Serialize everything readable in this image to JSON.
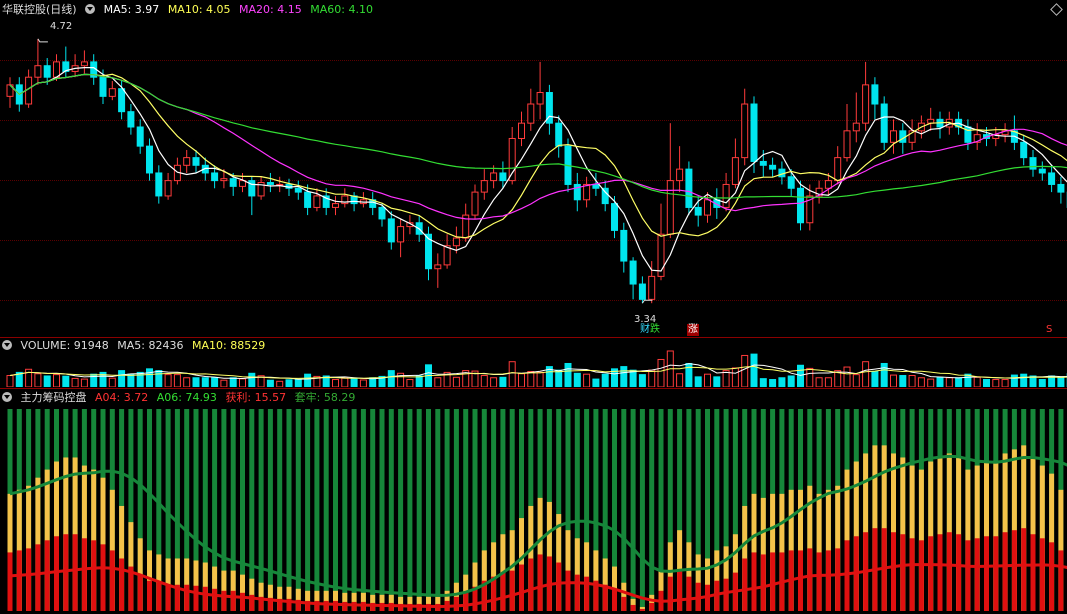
{
  "header": {
    "title": "华联控股(日线)",
    "ma5": "MA5: 3.97",
    "ma10": "MA10: 4.05",
    "ma20": "MA20: 4.15",
    "ma60": "MA60: 4.10"
  },
  "volume_header": {
    "label": "VOLUME: 91948",
    "ma5": "MA5: 82436",
    "ma10": "MA10: 88529"
  },
  "chip_header": {
    "title": "主力筹码控盘",
    "a04": "A04: 3.72",
    "a06": "A06: 74.93",
    "profit": "获利: 15.57",
    "trapped": "套牢: 58.29"
  },
  "annotations": {
    "high": "4.72",
    "low": "3.34",
    "signal_fall": "跌",
    "signal_finance": "财",
    "signal_rise": "涨",
    "signal_s": "S"
  },
  "colors": {
    "up": "#ff3b3b",
    "down": "#00e5ee",
    "ma5": "#ffffff",
    "ma10": "#ffff66",
    "ma20": "#ff33ff",
    "ma60": "#33dd33",
    "chip_green": "#16873a",
    "chip_gold": "#f4c34a",
    "chip_red": "#e01010"
  },
  "chart_data": [
    {
      "type": "candlestick",
      "title": "华联控股(日线)",
      "y_axis_range": [
        3.2,
        4.85
      ],
      "high_label": 4.72,
      "low_label": 3.34,
      "series": [
        {
          "name": "MA5",
          "last": 3.97
        },
        {
          "name": "MA10",
          "last": 4.05
        },
        {
          "name": "MA20",
          "last": 4.15
        },
        {
          "name": "MA60",
          "last": 4.1
        }
      ],
      "candles": [
        [
          4.42,
          4.48,
          4.36,
          4.52
        ],
        [
          4.48,
          4.38,
          4.34,
          4.52
        ],
        [
          4.38,
          4.52,
          4.36,
          4.56
        ],
        [
          4.52,
          4.58,
          4.48,
          4.72
        ],
        [
          4.58,
          4.52,
          4.48,
          4.62
        ],
        [
          4.52,
          4.6,
          4.5,
          4.64
        ],
        [
          4.6,
          4.55,
          4.52,
          4.68
        ],
        [
          4.55,
          4.58,
          4.52,
          4.64
        ],
        [
          4.58,
          4.6,
          4.54,
          4.66
        ],
        [
          4.6,
          4.52,
          4.48,
          4.64
        ],
        [
          4.52,
          4.42,
          4.38,
          4.56
        ],
        [
          4.42,
          4.46,
          4.4,
          4.5
        ],
        [
          4.46,
          4.34,
          4.3,
          4.5
        ],
        [
          4.34,
          4.26,
          4.22,
          4.38
        ],
        [
          4.26,
          4.16,
          4.12,
          4.3
        ],
        [
          4.16,
          4.02,
          3.98,
          4.2
        ],
        [
          4.02,
          3.9,
          3.86,
          4.06
        ],
        [
          3.9,
          3.98,
          3.88,
          4.02
        ],
        [
          3.98,
          4.06,
          3.96,
          4.1
        ],
        [
          4.06,
          4.1,
          4.02,
          4.14
        ],
        [
          4.1,
          4.06,
          4.02,
          4.14
        ],
        [
          4.06,
          4.02,
          3.98,
          4.1
        ],
        [
          4.02,
          3.98,
          3.94,
          4.06
        ],
        [
          3.98,
          3.99,
          3.94,
          4.04
        ],
        [
          3.99,
          3.95,
          3.9,
          4.02
        ],
        [
          3.95,
          3.98,
          3.92,
          4.02
        ],
        [
          3.98,
          3.9,
          3.8,
          4.0
        ],
        [
          3.9,
          3.97,
          3.88,
          4.0
        ],
        [
          3.97,
          3.96,
          3.92,
          4.02
        ],
        [
          3.96,
          3.96,
          3.92,
          4.0
        ],
        [
          3.96,
          3.94,
          3.9,
          3.99
        ],
        [
          3.94,
          3.92,
          3.88,
          3.98
        ],
        [
          3.92,
          3.84,
          3.8,
          3.96
        ],
        [
          3.84,
          3.9,
          3.82,
          3.94
        ],
        [
          3.9,
          3.84,
          3.8,
          3.94
        ],
        [
          3.84,
          3.86,
          3.8,
          3.9
        ],
        [
          3.86,
          3.9,
          3.84,
          3.94
        ],
        [
          3.9,
          3.86,
          3.82,
          3.92
        ],
        [
          3.86,
          3.88,
          3.84,
          3.92
        ],
        [
          3.88,
          3.84,
          3.8,
          3.92
        ],
        [
          3.84,
          3.78,
          3.74,
          3.86
        ],
        [
          3.78,
          3.66,
          3.62,
          3.82
        ],
        [
          3.66,
          3.74,
          3.58,
          3.78
        ],
        [
          3.74,
          3.76,
          3.7,
          3.8
        ],
        [
          3.76,
          3.7,
          3.66,
          3.8
        ],
        [
          3.7,
          3.52,
          3.46,
          3.74
        ],
        [
          3.52,
          3.54,
          3.42,
          3.6
        ],
        [
          3.54,
          3.64,
          3.52,
          3.7
        ],
        [
          3.64,
          3.68,
          3.6,
          3.74
        ],
        [
          3.68,
          3.8,
          3.66,
          3.86
        ],
        [
          3.8,
          3.92,
          3.78,
          3.96
        ],
        [
          3.92,
          3.98,
          3.88,
          4.04
        ],
        [
          3.98,
          4.02,
          3.94,
          4.06
        ],
        [
          4.02,
          3.98,
          3.94,
          4.08
        ],
        [
          3.98,
          4.2,
          3.96,
          4.26
        ],
        [
          4.2,
          4.28,
          4.16,
          4.34
        ],
        [
          4.28,
          4.38,
          4.24,
          4.46
        ],
        [
          4.38,
          4.44,
          4.3,
          4.6
        ],
        [
          4.44,
          4.28,
          4.22,
          4.48
        ],
        [
          4.28,
          4.16,
          4.1,
          4.32
        ],
        [
          4.16,
          3.96,
          3.92,
          4.2
        ],
        [
          3.96,
          3.88,
          3.82,
          4.02
        ],
        [
          3.88,
          3.96,
          3.84,
          4.0
        ],
        [
          3.96,
          3.94,
          3.9,
          4.02
        ],
        [
          3.94,
          3.86,
          3.82,
          3.98
        ],
        [
          3.86,
          3.72,
          3.68,
          3.9
        ],
        [
          3.72,
          3.56,
          3.5,
          3.76
        ],
        [
          3.56,
          3.44,
          3.36,
          3.58
        ],
        [
          3.44,
          3.36,
          3.34,
          3.48
        ],
        [
          3.36,
          3.48,
          3.34,
          3.56
        ],
        [
          3.48,
          3.7,
          3.46,
          3.86
        ],
        [
          3.7,
          3.98,
          3.68,
          4.28
        ],
        [
          3.98,
          4.04,
          3.92,
          4.16
        ],
        [
          4.04,
          3.84,
          3.8,
          4.08
        ],
        [
          3.84,
          3.8,
          3.74,
          3.9
        ],
        [
          3.8,
          3.88,
          3.76,
          3.92
        ],
        [
          3.88,
          3.84,
          3.78,
          3.94
        ],
        [
          3.84,
          3.96,
          3.82,
          4.02
        ],
        [
          3.96,
          4.1,
          3.94,
          4.2
        ],
        [
          4.1,
          4.38,
          4.06,
          4.46
        ],
        [
          4.38,
          4.08,
          4.02,
          4.42
        ],
        [
          4.08,
          4.06,
          4.0,
          4.14
        ],
        [
          4.06,
          4.04,
          4.0,
          4.1
        ],
        [
          4.04,
          4.0,
          3.96,
          4.08
        ],
        [
          4.0,
          3.94,
          3.9,
          4.04
        ],
        [
          3.94,
          3.76,
          3.72,
          3.98
        ],
        [
          3.76,
          3.9,
          3.72,
          3.96
        ],
        [
          3.9,
          3.94,
          3.86,
          3.98
        ],
        [
          3.94,
          3.98,
          3.9,
          4.02
        ],
        [
          3.98,
          4.1,
          3.96,
          4.16
        ],
        [
          4.1,
          4.24,
          4.08,
          4.38
        ],
        [
          4.24,
          4.28,
          4.18,
          4.44
        ],
        [
          4.28,
          4.48,
          4.24,
          4.6
        ],
        [
          4.48,
          4.38,
          4.3,
          4.52
        ],
        [
          4.38,
          4.18,
          4.14,
          4.42
        ],
        [
          4.18,
          4.24,
          4.12,
          4.3
        ],
        [
          4.24,
          4.18,
          4.12,
          4.28
        ],
        [
          4.18,
          4.24,
          4.14,
          4.3
        ],
        [
          4.24,
          4.28,
          4.2,
          4.32
        ],
        [
          4.28,
          4.3,
          4.24,
          4.36
        ],
        [
          4.3,
          4.26,
          4.2,
          4.34
        ],
        [
          4.26,
          4.3,
          4.22,
          4.34
        ],
        [
          4.3,
          4.26,
          4.22,
          4.34
        ],
        [
          4.26,
          4.18,
          4.14,
          4.3
        ],
        [
          4.18,
          4.22,
          4.14,
          4.28
        ],
        [
          4.22,
          4.2,
          4.16,
          4.26
        ],
        [
          4.2,
          4.22,
          4.16,
          4.26
        ],
        [
          4.22,
          4.24,
          4.18,
          4.28
        ],
        [
          4.24,
          4.18,
          4.14,
          4.32
        ],
        [
          4.18,
          4.1,
          4.06,
          4.22
        ],
        [
          4.1,
          4.04,
          4.0,
          4.14
        ],
        [
          4.04,
          4.02,
          3.98,
          4.08
        ],
        [
          4.02,
          3.96,
          3.92,
          4.06
        ],
        [
          3.96,
          3.92,
          3.86,
          4.0
        ],
        [
          3.92,
          3.84,
          3.78,
          3.96
        ]
      ]
    },
    {
      "type": "bar",
      "title": "VOLUME",
      "values": [
        91948
      ],
      "series": [
        {
          "name": "MA5",
          "last": 82436
        },
        {
          "name": "MA10",
          "last": 88529
        }
      ]
    },
    {
      "type": "bar",
      "title": "主力筹码控盘",
      "series": [
        {
          "name": "A04",
          "last": 3.72
        },
        {
          "name": "A06",
          "last": 74.93
        },
        {
          "name": "获利",
          "last": 15.57
        },
        {
          "name": "套牢",
          "last": 58.29
        }
      ],
      "profit_series": [
        58,
        60,
        62,
        66,
        70,
        74,
        76,
        76,
        72,
        70,
        66,
        60,
        52,
        44,
        36,
        30,
        28,
        26,
        26,
        26,
        25,
        24,
        22,
        20,
        20,
        18,
        16,
        14,
        13,
        12,
        12,
        11,
        10,
        10,
        10,
        10,
        9,
        9,
        9,
        8,
        8,
        8,
        7,
        7,
        7,
        7,
        7,
        10,
        14,
        18,
        24,
        30,
        34,
        38,
        40,
        46,
        52,
        56,
        54,
        48,
        40,
        36,
        34,
        30,
        26,
        22,
        14,
        6,
        2,
        8,
        20,
        34,
        40,
        34,
        28,
        26,
        30,
        32,
        38,
        52,
        58,
        56,
        58,
        58,
        60,
        60,
        62,
        58,
        60,
        62,
        70,
        74,
        78,
        82,
        82,
        78,
        76,
        72,
        70,
        74,
        76,
        78,
        76,
        70,
        72,
        74,
        74,
        78,
        80,
        82,
        76,
        72,
        68,
        60,
        52,
        40,
        32
      ]
    }
  ]
}
